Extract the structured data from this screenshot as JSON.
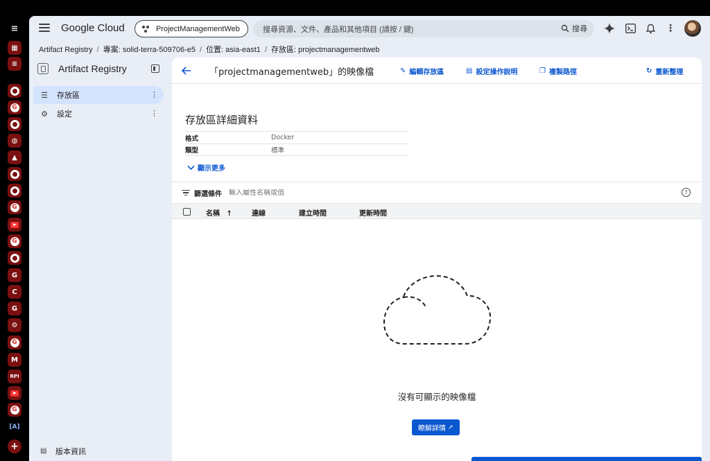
{
  "header": {
    "logo": "Google Cloud",
    "project": "ProjectManagementWeb",
    "search_placeholder": "搜尋資源、文件、產品和其他項目 (請按 / 鍵)",
    "search_button": "搜尋"
  },
  "breadcrumb": [
    "Artifact Registry",
    "專案: solid-terra-509706-e5",
    "位置: asia-east1",
    "存放區: projectmanagementweb"
  ],
  "sidebar": {
    "title": "Artifact Registry",
    "items": [
      {
        "label": "存放區",
        "icon": "list-icon",
        "active": true
      },
      {
        "label": "設定",
        "icon": "gear-icon",
        "active": false
      }
    ],
    "footer": "版本資訊"
  },
  "main": {
    "title": "「projectmanagementweb」的映像檔",
    "actions": {
      "edit": "編輯存放區",
      "setup": "設定操作說明",
      "copy": "複製路徑",
      "refresh": "重新整理"
    },
    "details": {
      "heading": "存放區詳細資料",
      "rows": [
        {
          "key": "格式",
          "value": "Docker"
        },
        {
          "key": "類型",
          "value": "標準"
        }
      ],
      "show_more": "顯示更多"
    },
    "filter": {
      "label": "篩選條件",
      "placeholder": "輸入屬性名稱或值"
    },
    "table": {
      "columns": [
        "名稱",
        "連線",
        "建立時間",
        "更新時間"
      ]
    },
    "empty": {
      "message": "沒有可顯示的映像檔",
      "button": "瞭解詳情"
    }
  },
  "rail": {
    "top_icon": "≡",
    "apps": [
      "RPI"
    ]
  },
  "colors": {
    "accent": "#0b57d0",
    "app_bg": "#e9eef6",
    "active_nav": "#d3e3fd"
  }
}
